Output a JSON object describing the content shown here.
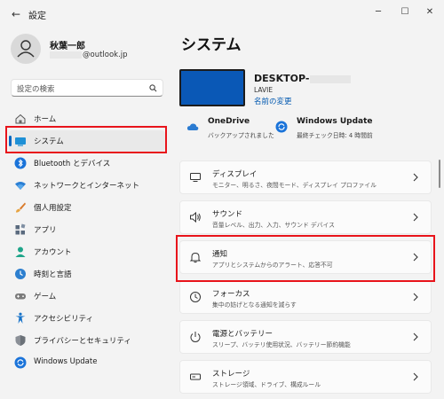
{
  "window": {
    "title": "設定",
    "back_glyph": "←",
    "minimize": "─",
    "maximize": "☐",
    "close": "✕"
  },
  "profile": {
    "name": "秋葉一郎",
    "email_visible": "@outlook.jp"
  },
  "search": {
    "placeholder": "設定の検索"
  },
  "nav": {
    "items": [
      {
        "label": "ホーム",
        "icon": "home-icon"
      },
      {
        "label": "システム",
        "icon": "system-icon",
        "active": true
      },
      {
        "label": "Bluetooth とデバイス",
        "icon": "bluetooth-icon"
      },
      {
        "label": "ネットワークとインターネット",
        "icon": "network-icon"
      },
      {
        "label": "個人用設定",
        "icon": "brush-icon"
      },
      {
        "label": "アプリ",
        "icon": "apps-icon"
      },
      {
        "label": "アカウント",
        "icon": "account-icon"
      },
      {
        "label": "時刻と言語",
        "icon": "time-language-icon"
      },
      {
        "label": "ゲーム",
        "icon": "gamepad-icon"
      },
      {
        "label": "アクセシビリティ",
        "icon": "accessibility-icon"
      },
      {
        "label": "プライバシーとセキュリティ",
        "icon": "shield-icon"
      },
      {
        "label": "Windows Update",
        "icon": "windows-update-icon"
      }
    ]
  },
  "main": {
    "title": "システム",
    "device": {
      "name_prefix": "DESKTOP-",
      "model": "LAVIE",
      "rename": "名前の変更"
    },
    "onedrive": {
      "title": "OneDrive",
      "sub": "バックアップされました"
    },
    "windows_update": {
      "title": "Windows Update",
      "sub": "最終チェック日時: 4 時間前"
    },
    "cards": [
      {
        "title": "ディスプレイ",
        "sub": "モニター、明るさ、夜間モード、ディスプレイ プロファイル",
        "icon": "display-icon"
      },
      {
        "title": "サウンド",
        "sub": "音量レベル、出力、入力、サウンド デバイス",
        "icon": "speaker-icon"
      },
      {
        "title": "通知",
        "sub": "アプリとシステムからのアラート、応答不可",
        "icon": "bell-icon"
      },
      {
        "title": "フォーカス",
        "sub": "集中の妨げとなる通知を減らす",
        "icon": "focus-icon"
      },
      {
        "title": "電源とバッテリー",
        "sub": "スリープ、バッテリ使用状況、バッテリー節約機能",
        "icon": "power-icon"
      },
      {
        "title": "ストレージ",
        "sub": "ストレージ領域、ドライブ、構成ルール",
        "icon": "storage-icon"
      }
    ]
  },
  "colors": {
    "accent": "#0067c0",
    "highlight_box": "#e8141b",
    "device_screen": "#0a58b6"
  }
}
